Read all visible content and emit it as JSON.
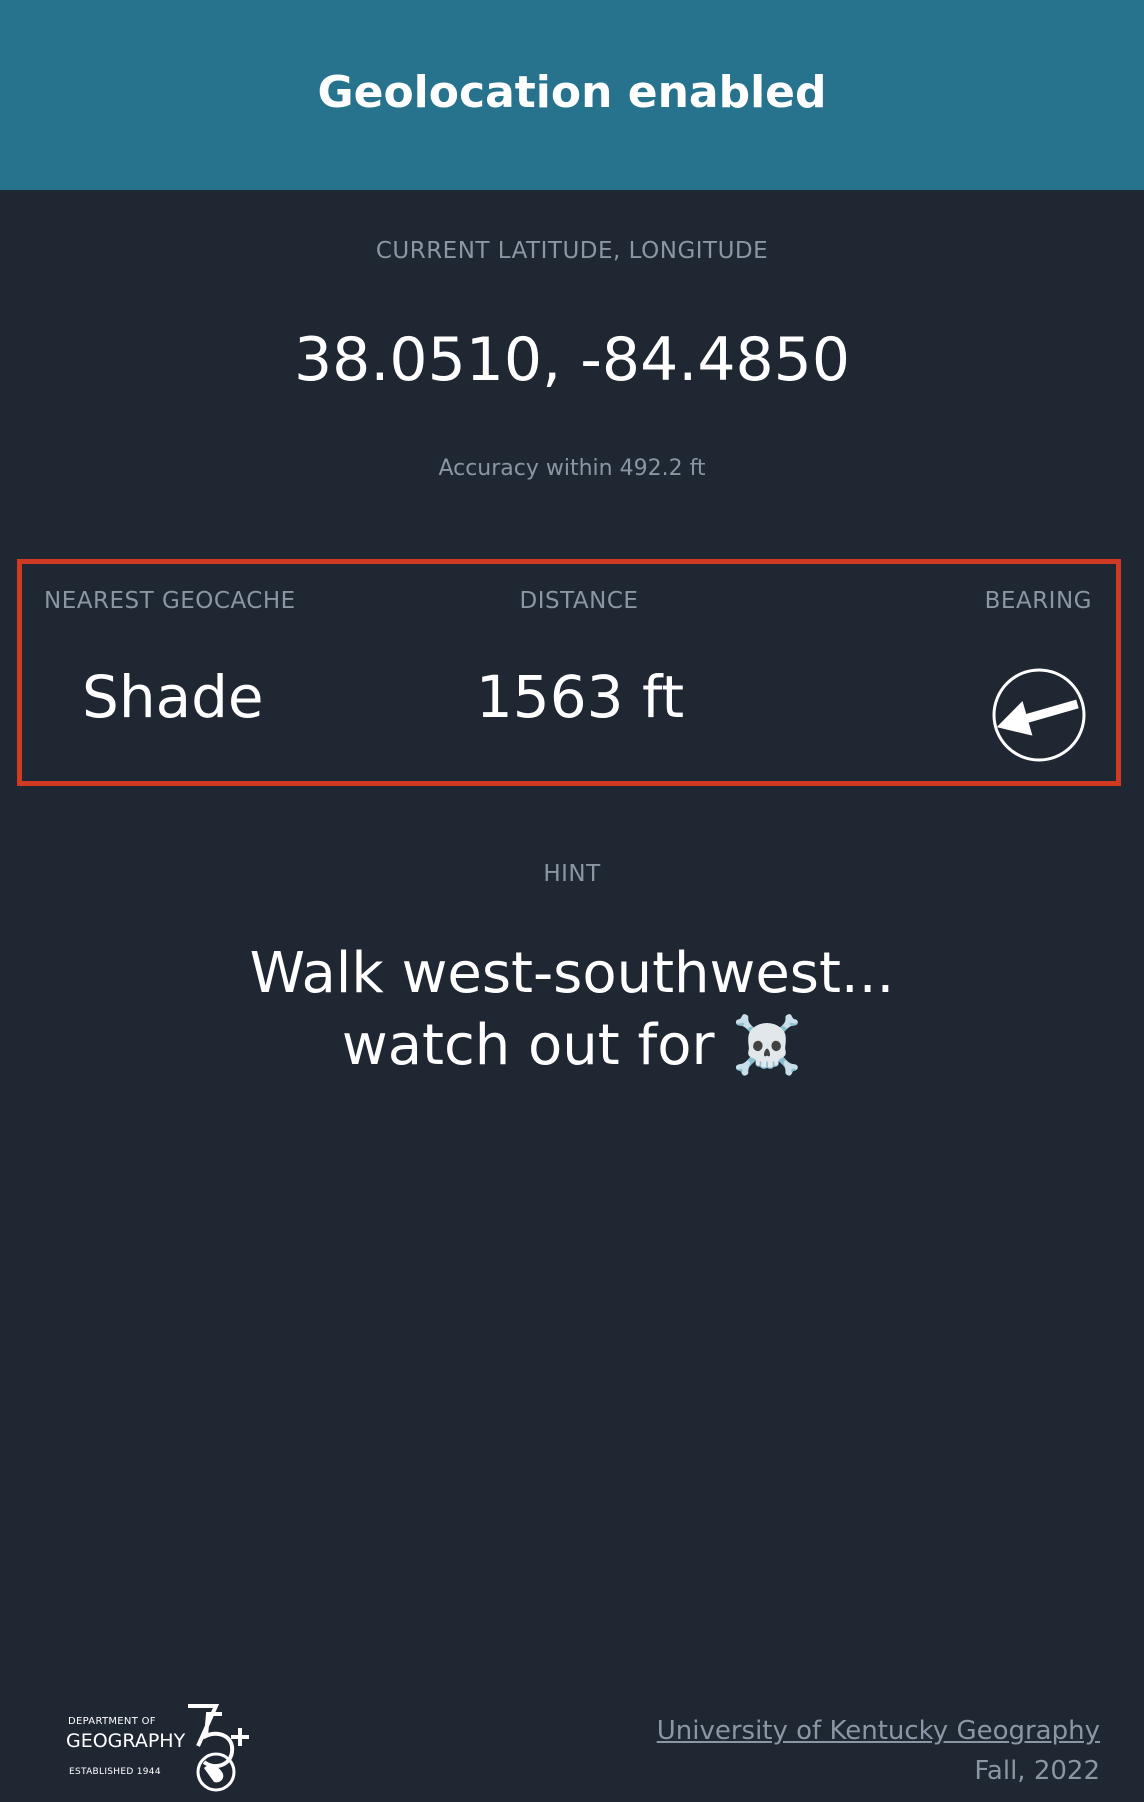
{
  "header": {
    "title": "Geolocation enabled"
  },
  "location": {
    "label": "CURRENT LATITUDE, LONGITUDE",
    "coordinates": "38.0510, -84.4850",
    "accuracy": "Accuracy within 492.2 ft"
  },
  "geocache": {
    "name_label": "NEAREST GEOCACHE",
    "name": "Shade",
    "distance_label": "DISTANCE",
    "distance": "1563 ft",
    "bearing_label": "BEARING",
    "bearing_icon": "arrow-circle-icon",
    "border_color": "#d03a22"
  },
  "hint": {
    "label": "HINT",
    "line1": "Walk west-southwest...",
    "line2": "watch out for ☠️"
  },
  "footer": {
    "logo": {
      "dept": "DEPARTMENT OF",
      "name": "GEOGRAPHY",
      "established": "ESTABLISHED 1944",
      "mark": "75+"
    },
    "link_text": "University of Kentucky Geography",
    "term": "Fall, 2022"
  },
  "colors": {
    "header_bg": "#27738e",
    "page_bg": "#1f2733",
    "muted_text": "#8b95a3",
    "accent_border": "#d03a22"
  }
}
